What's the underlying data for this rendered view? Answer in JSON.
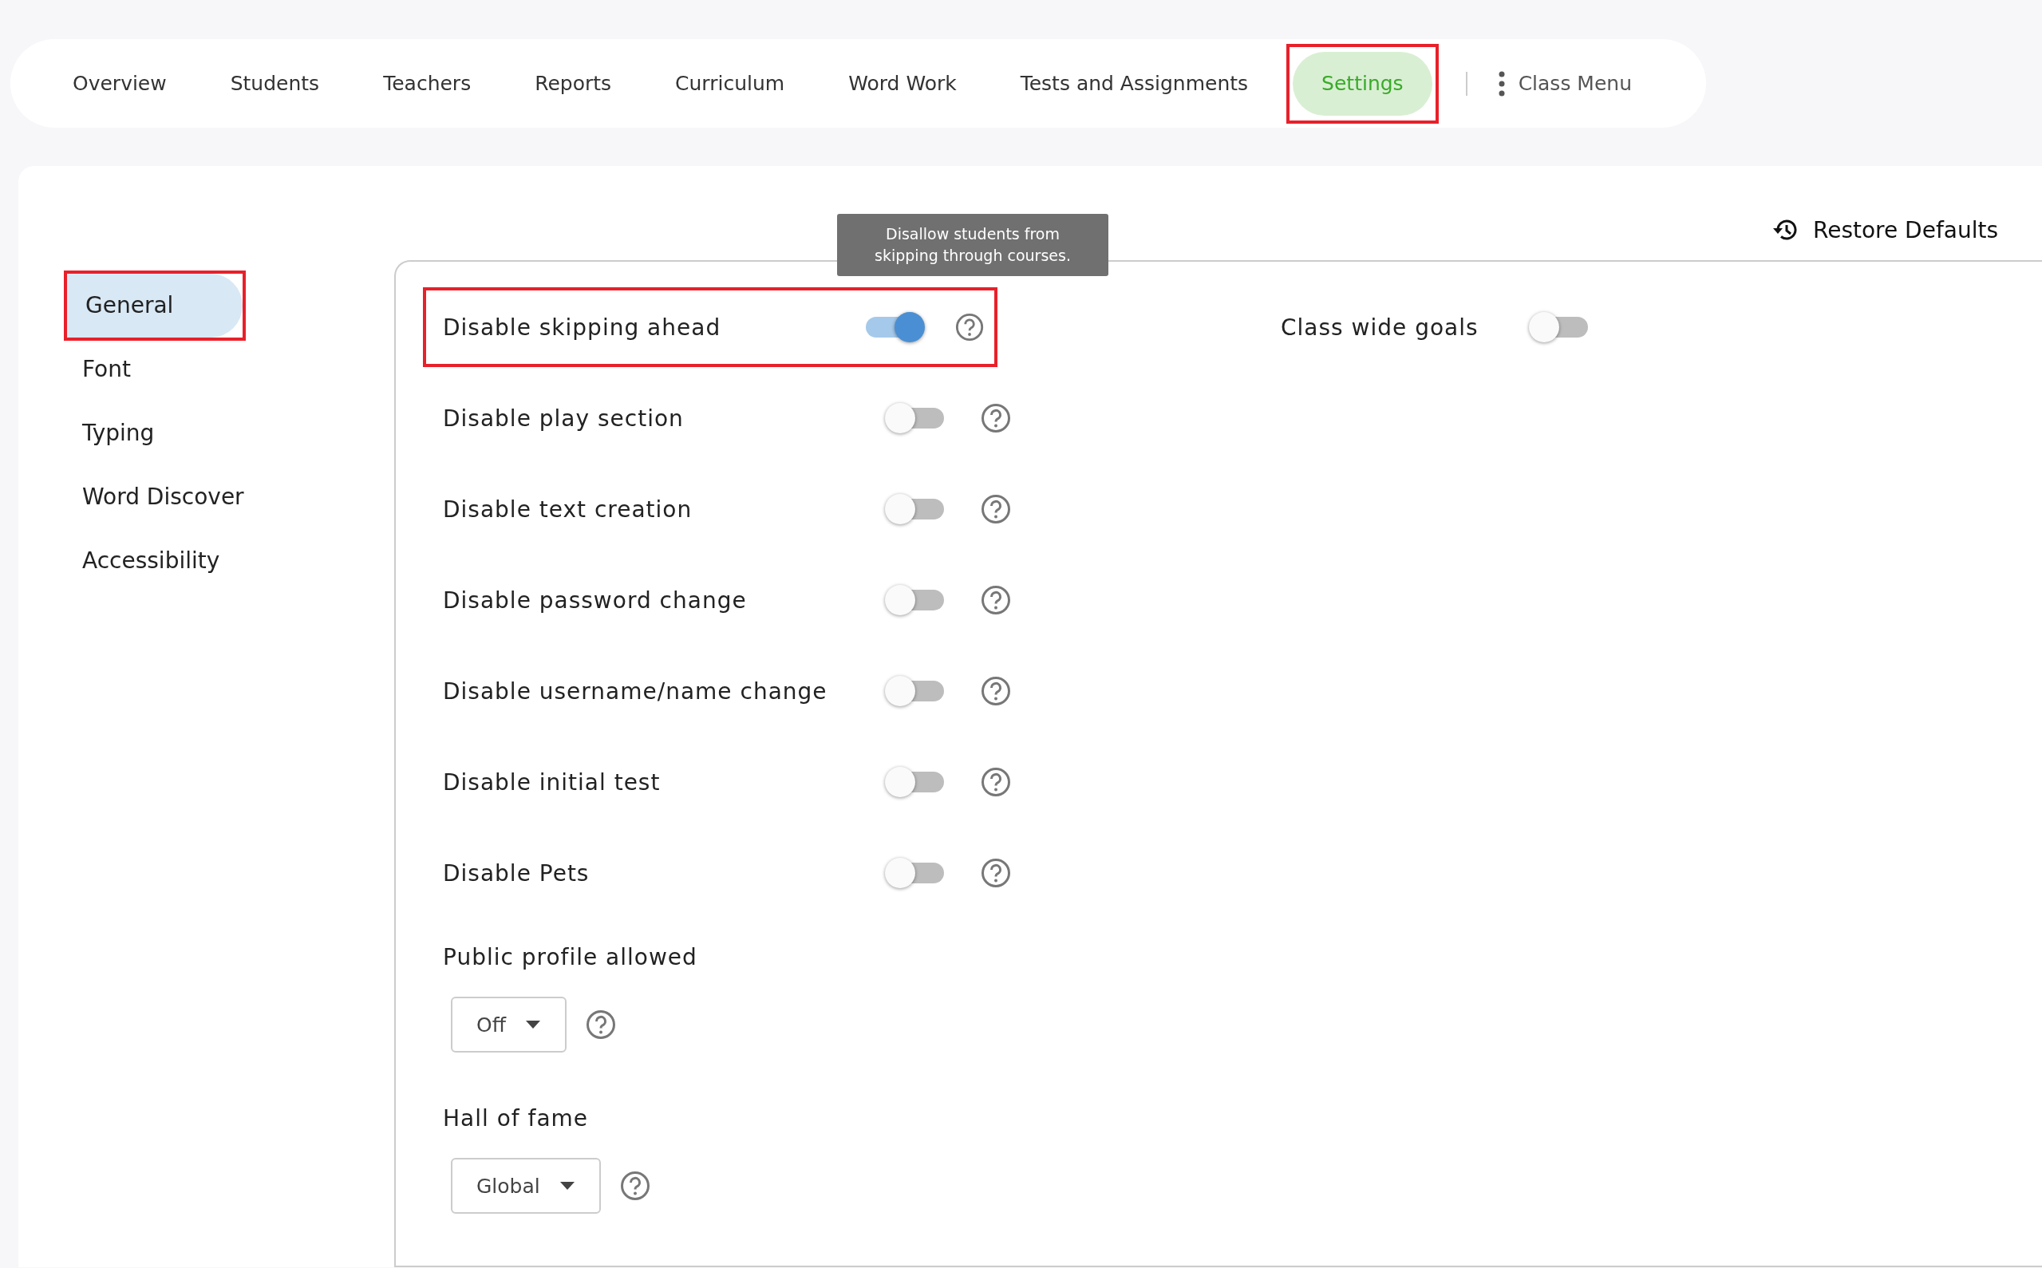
{
  "nav": {
    "tabs": [
      {
        "label": "Overview",
        "selected": false,
        "highlighted": false
      },
      {
        "label": "Students",
        "selected": false,
        "highlighted": false
      },
      {
        "label": "Teachers",
        "selected": false,
        "highlighted": false
      },
      {
        "label": "Reports",
        "selected": false,
        "highlighted": false
      },
      {
        "label": "Curriculum",
        "selected": false,
        "highlighted": false
      },
      {
        "label": "Word Work",
        "selected": false,
        "highlighted": false
      },
      {
        "label": "Tests and Assignments",
        "selected": false,
        "highlighted": false
      },
      {
        "label": "Settings",
        "selected": true,
        "highlighted": true
      }
    ],
    "menu": {
      "label": "Class Menu"
    }
  },
  "restore": {
    "label": "Restore Defaults"
  },
  "sidebar": {
    "items": [
      {
        "label": "General",
        "selected": true,
        "highlighted": true
      },
      {
        "label": "Font",
        "selected": false,
        "highlighted": false
      },
      {
        "label": "Typing",
        "selected": false,
        "highlighted": false
      },
      {
        "label": "Word Discover",
        "selected": false,
        "highlighted": false
      },
      {
        "label": "Accessibility",
        "selected": false,
        "highlighted": false
      }
    ]
  },
  "tooltip": {
    "text": "Disallow students from skipping through courses."
  },
  "settings": [
    {
      "kind": "toggle",
      "label": "Disable skipping ahead",
      "on": true,
      "highlighted": true
    },
    {
      "kind": "toggle",
      "label": "Disable play section",
      "on": false,
      "highlighted": false
    },
    {
      "kind": "toggle",
      "label": "Disable text creation",
      "on": false,
      "highlighted": false
    },
    {
      "kind": "toggle",
      "label": "Disable password change",
      "on": false,
      "highlighted": false
    },
    {
      "kind": "toggle",
      "label": "Disable username/name change",
      "on": false,
      "highlighted": false
    },
    {
      "kind": "toggle",
      "label": "Disable initial test",
      "on": false,
      "highlighted": false
    },
    {
      "kind": "toggle",
      "label": "Disable Pets",
      "on": false,
      "highlighted": false
    },
    {
      "kind": "dropdown",
      "label": "Public profile allowed",
      "value": "Off",
      "highlighted": false
    },
    {
      "kind": "dropdown",
      "label": "Hall of fame",
      "value": "Global",
      "highlighted": false
    }
  ],
  "side_settings": [
    {
      "kind": "toggle",
      "label": "Class wide goals",
      "on": false,
      "highlighted": false
    }
  ]
}
